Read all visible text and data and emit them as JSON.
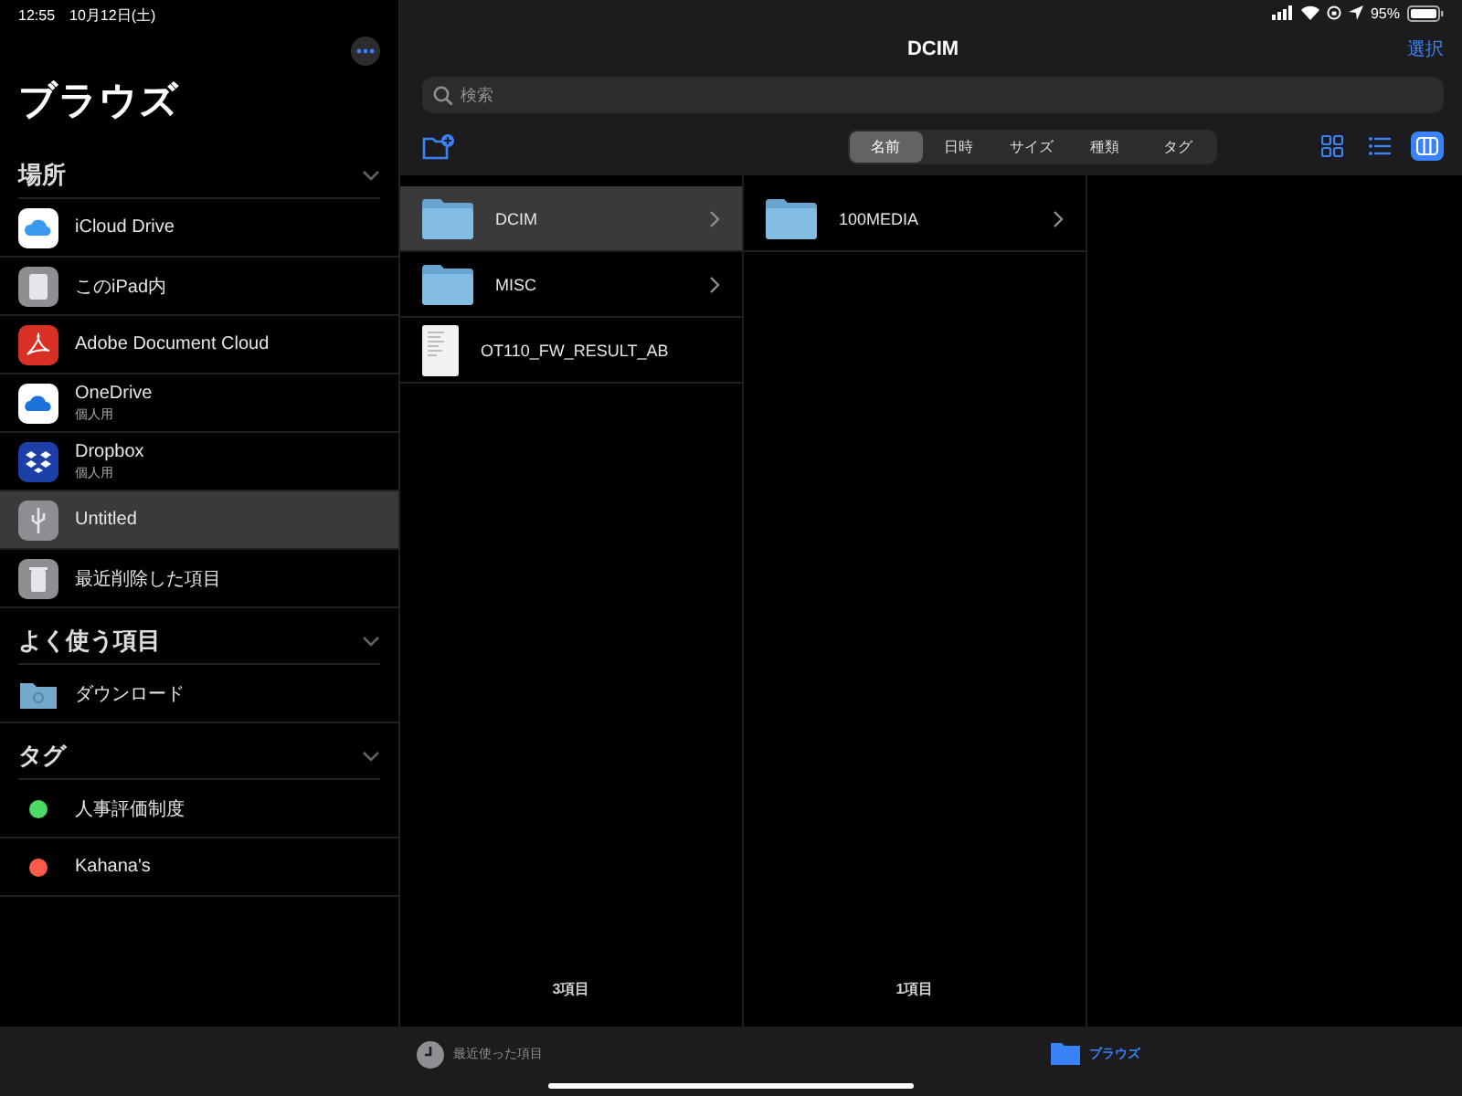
{
  "status_bar": {
    "time": "12:55",
    "date": "10月12日(土)",
    "battery": "95%"
  },
  "sidebar": {
    "title": "ブラウズ",
    "sections": [
      {
        "title": "場所",
        "expanded": true,
        "items": [
          {
            "label": "iCloud Drive",
            "kind": "icloud",
            "selected": false
          },
          {
            "label": "このiPad内",
            "kind": "ipad",
            "selected": false
          },
          {
            "label": "Adobe Document Cloud",
            "kind": "adobe",
            "selected": false
          },
          {
            "label": "OneDrive",
            "subtitle": "個人用",
            "kind": "onedrive",
            "selected": false
          },
          {
            "label": "Dropbox",
            "subtitle": "個人用",
            "kind": "dropbox",
            "selected": false
          },
          {
            "label": "Untitled",
            "kind": "usb",
            "selected": true
          },
          {
            "label": "最近削除した項目",
            "kind": "trash",
            "selected": false
          }
        ]
      },
      {
        "title": "よく使う項目",
        "expanded": true,
        "items": [
          {
            "label": "ダウンロード",
            "kind": "folder",
            "selected": false
          }
        ]
      },
      {
        "title": "タグ",
        "expanded": true,
        "items": [
          {
            "label": "人事評価制度",
            "kind": "tag",
            "color": "#4cd964",
            "selected": false
          },
          {
            "label": "Kahana's",
            "kind": "tag",
            "color": "#ff5a4a",
            "selected": false
          }
        ]
      }
    ]
  },
  "main": {
    "title": "DCIM",
    "select_button": "選択",
    "search": {
      "placeholder": "検索"
    },
    "sort_tabs": [
      {
        "label": "名前",
        "selected": true
      },
      {
        "label": "日時",
        "selected": false
      },
      {
        "label": "サイズ",
        "selected": false
      },
      {
        "label": "種類",
        "selected": false
      },
      {
        "label": "タグ",
        "selected": false
      }
    ],
    "view_modes": [
      {
        "kind": "grid",
        "selected": false
      },
      {
        "kind": "list",
        "selected": false
      },
      {
        "kind": "columns",
        "selected": true
      }
    ],
    "columns": [
      {
        "footer": "3項目",
        "items": [
          {
            "name": "DCIM",
            "kind": "folder",
            "selected": true
          },
          {
            "name": "MISC",
            "kind": "folder",
            "selected": false
          },
          {
            "name": "OT110_FW_RESULT_AB",
            "kind": "document",
            "selected": false
          }
        ]
      },
      {
        "footer": "1項目",
        "items": [
          {
            "name": "100MEDIA",
            "kind": "folder",
            "selected": false
          }
        ]
      }
    ]
  },
  "tab_bar": [
    {
      "label": "最近使った項目",
      "kind": "recents",
      "selected": false
    },
    {
      "label": "ブラウズ",
      "kind": "browse",
      "selected": true
    }
  ]
}
